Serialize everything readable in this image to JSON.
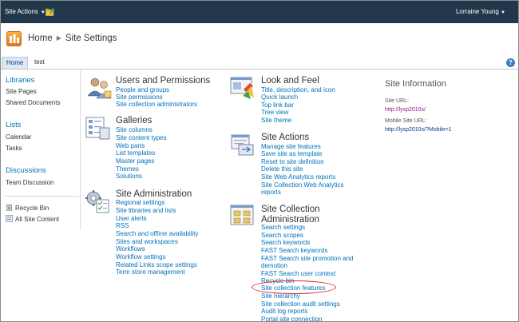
{
  "ribbon": {
    "site_actions_label": "Site Actions",
    "user_name": "Lorraine Young",
    "bg_color": "#21374c"
  },
  "title": {
    "home": "Home",
    "current": "Site Settings"
  },
  "topnav": {
    "tabs": [
      "Home",
      "test"
    ],
    "help_label": "?"
  },
  "quicklaunch": {
    "libraries": "Libraries",
    "site_pages": "Site Pages",
    "shared_documents": "Shared Documents",
    "lists": "Lists",
    "calendar": "Calendar",
    "tasks": "Tasks",
    "discussions": "Discussions",
    "team_discussion": "Team Discussion",
    "recycle_bin": "Recycle Bin",
    "all_site_content": "All Site Content"
  },
  "sections": {
    "users": {
      "title": "Users and Permissions",
      "links": [
        "People and groups",
        "Site permissions",
        "Site collection administrators"
      ]
    },
    "galleries": {
      "title": "Galleries",
      "links": [
        "Site columns",
        "Site content types",
        "Web parts",
        "List templates",
        "Master pages",
        "Themes",
        "Solutions"
      ]
    },
    "admin": {
      "title": "Site Administration",
      "links": [
        "Regional settings",
        "Site libraries and lists",
        "User alerts",
        "RSS",
        "Search and offline availability",
        "Sites and workspaces",
        "Workflows",
        "Workflow settings",
        "Related Links scope settings",
        "Term store management"
      ]
    },
    "look": {
      "title": "Look and Feel",
      "links": [
        "Title, description, and icon",
        "Quick launch",
        "Top link bar",
        "Tree view",
        "Site theme"
      ]
    },
    "actions": {
      "title": "Site Actions",
      "links": [
        "Manage site features",
        "Save site as template",
        "Reset to site definition",
        "Delete this site",
        "Site Web Analytics reports",
        "Site Collection Web Analytics",
        "reports"
      ]
    },
    "collection": {
      "title_line1": "Site Collection",
      "title_line2": "Administration",
      "links": [
        "Search settings",
        "Search scopes",
        "Search keywords",
        "FAST Search keywords",
        "FAST Search site promotion and",
        "demotion",
        "FAST Search user context",
        "Recycle bin",
        "Site collection features",
        "Site hierarchy",
        "Site collection audit settings",
        "Audit log reports",
        "Portal site connection"
      ]
    }
  },
  "site_info": {
    "heading": "Site Information",
    "url_label": "Site URL:",
    "url_value": "http://lysp2010s/",
    "mobile_label": "Mobile Site URL:",
    "mobile_value": "http://lysp2010s/?Mobile=1"
  },
  "highlight_color": "#e0262a"
}
